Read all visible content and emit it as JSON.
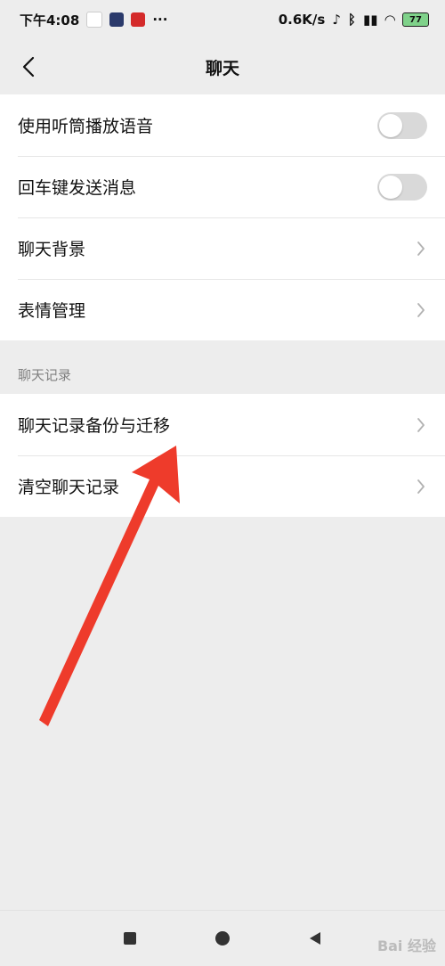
{
  "status": {
    "time": "下午4:08",
    "dots": "···",
    "speed": "0.6K/s",
    "battery": "77"
  },
  "nav": {
    "title": "聊天"
  },
  "settings": {
    "group1": [
      {
        "label": "使用听筒播放语音",
        "control": "toggle",
        "on": false
      },
      {
        "label": "回车键发送消息",
        "control": "toggle",
        "on": false
      },
      {
        "label": "聊天背景",
        "control": "chevron"
      },
      {
        "label": "表情管理",
        "control": "chevron"
      }
    ],
    "section2_header": "聊天记录",
    "group2": [
      {
        "label": "聊天记录备份与迁移",
        "control": "chevron"
      },
      {
        "label": "清空聊天记录",
        "control": "chevron"
      }
    ]
  },
  "watermark": "Bai 经验",
  "colors": {
    "background": "#ededed",
    "annotation_arrow": "#ee3b2b"
  }
}
